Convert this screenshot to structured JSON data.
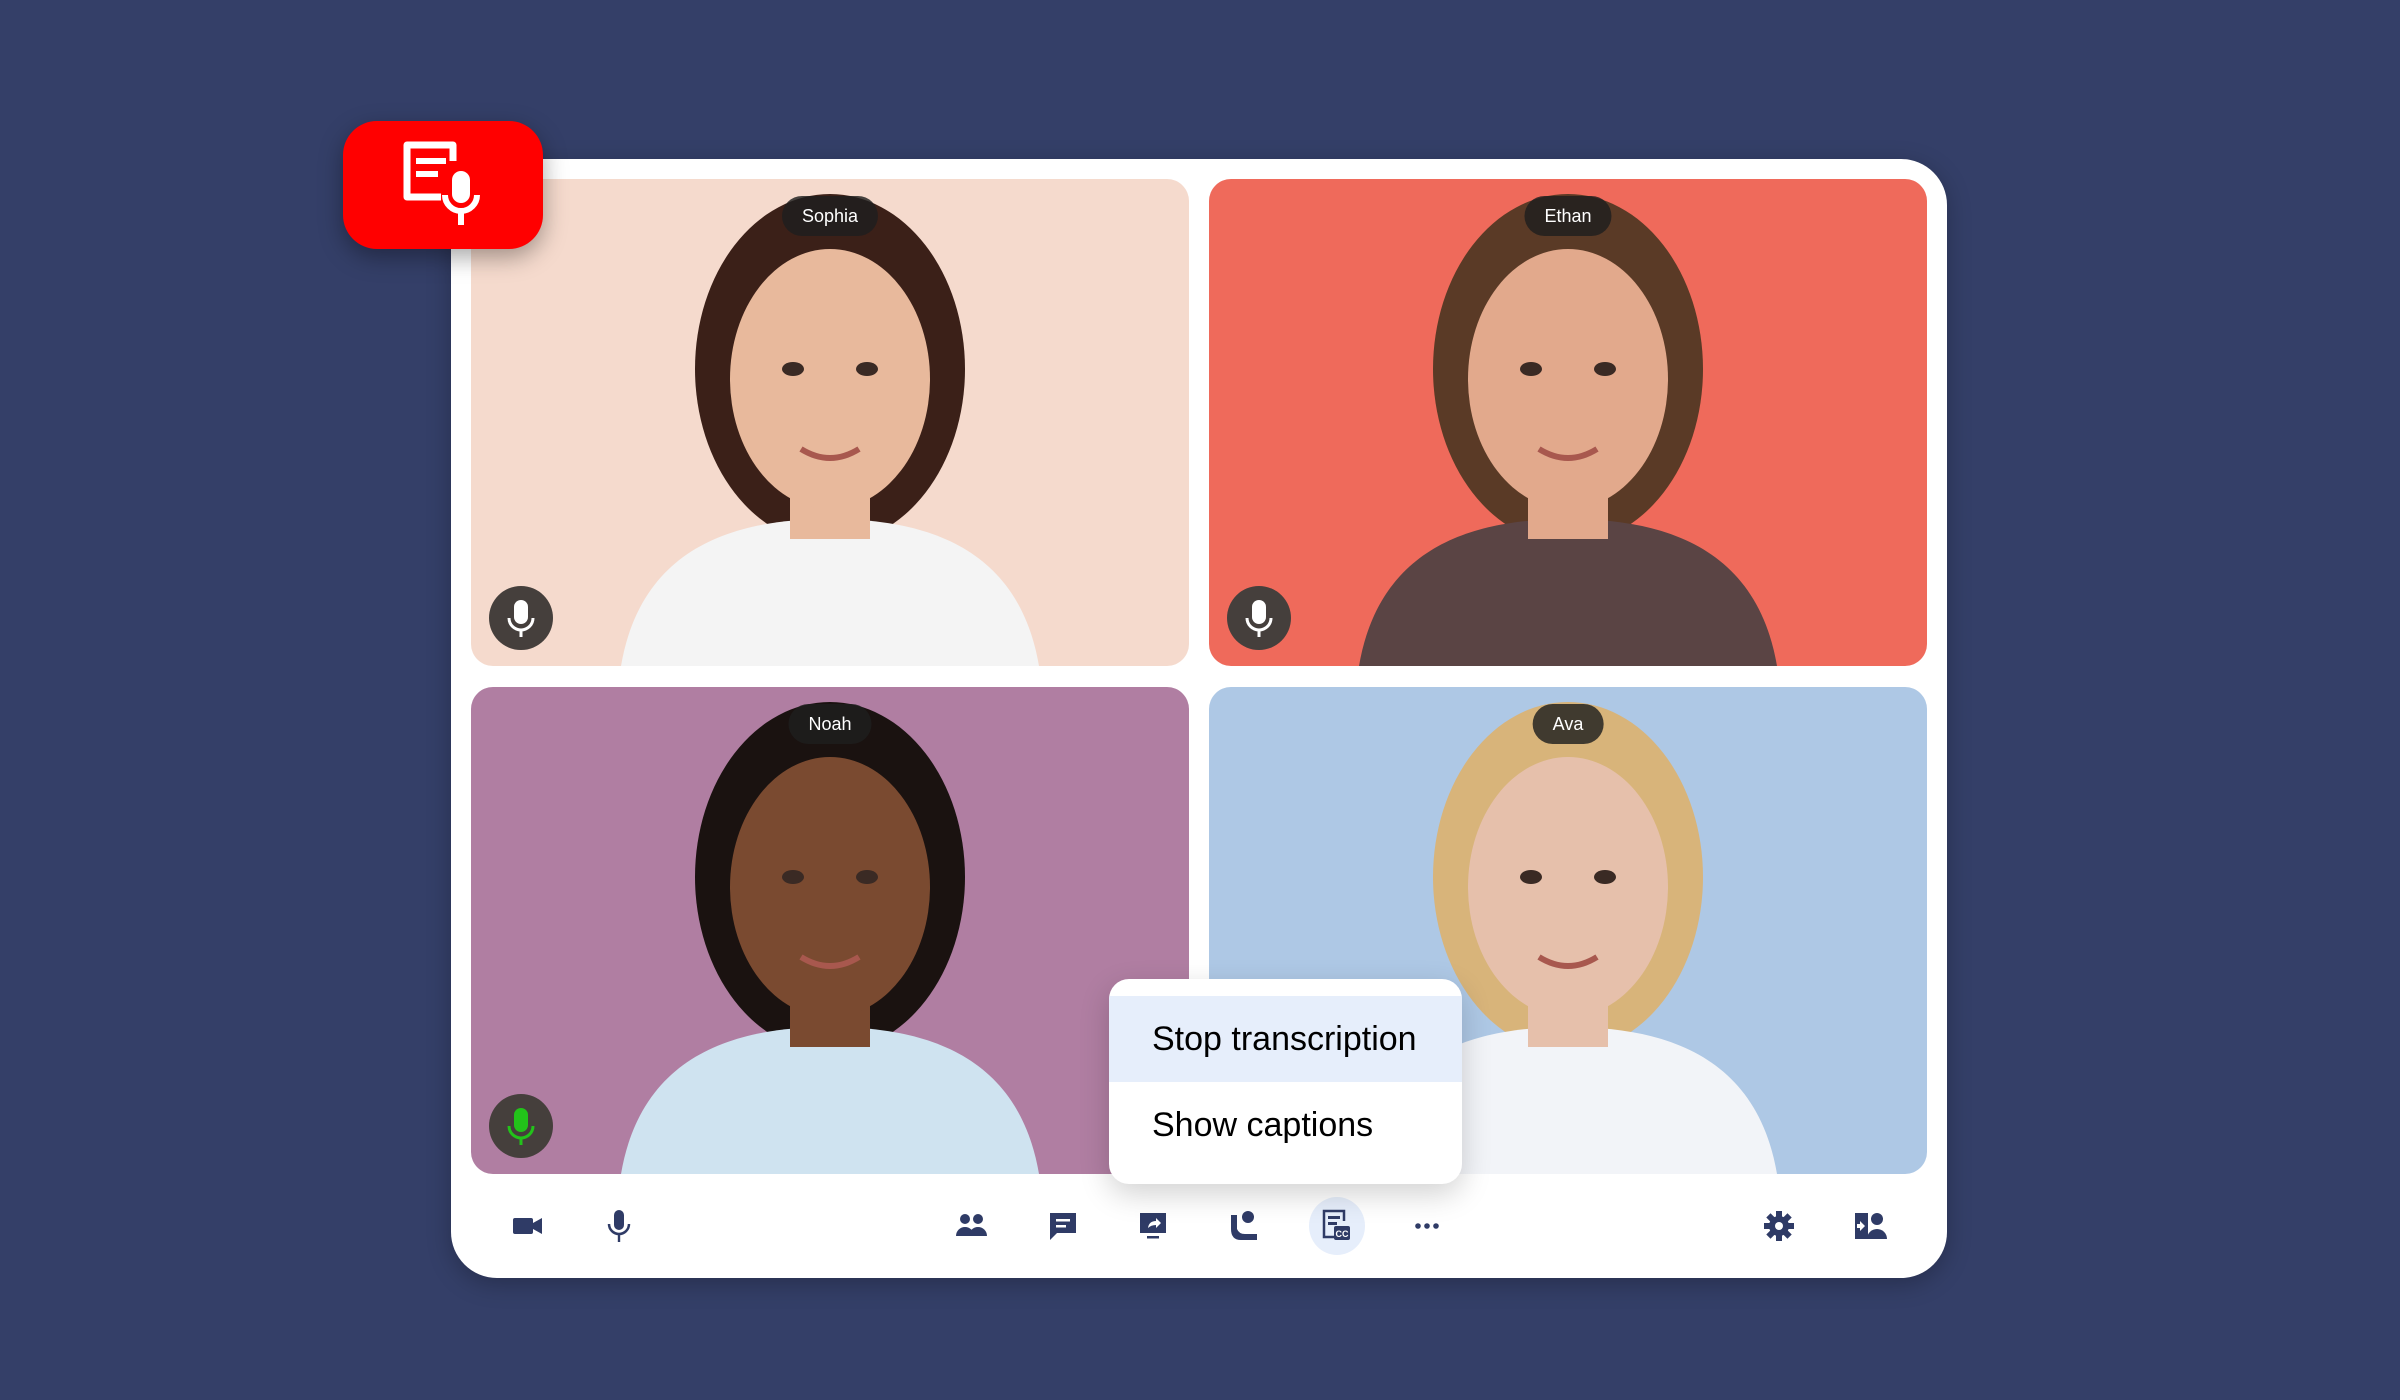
{
  "colors": {
    "background": "#343f68",
    "card": "#ffffff",
    "badge": "#ff0000",
    "icon": "#2f3b66",
    "active_highlight": "#e6eefb",
    "mic_active": "#22c31a",
    "mic_idle": "#ffffff"
  },
  "badge": {
    "icon": "transcription-icon"
  },
  "participants": [
    {
      "name": "Sophia",
      "bg": "#f5dacd",
      "mic": "mic-idle",
      "skin": "#e8b99c",
      "hair": "#3b2018",
      "shirt": "#f4f4f4"
    },
    {
      "name": "Ethan",
      "bg": "#ef6a5b",
      "mic": "mic-idle",
      "skin": "#e2a98c",
      "hair": "#5a3a26",
      "shirt": "#5a4444"
    },
    {
      "name": "Noah",
      "bg": "#b07ea2",
      "mic": "mic-active",
      "skin": "#7a4a30",
      "hair": "#1a1210",
      "shirt": "#cfe3f0"
    },
    {
      "name": "Ava",
      "bg": "#aec8e5",
      "mic": "mic-idle",
      "skin": "#e6c0ab",
      "hair": "#d8b47a",
      "shirt": "#f2f4f8"
    }
  ],
  "menu": {
    "items": [
      {
        "label": "Stop transcription",
        "highlighted": true
      },
      {
        "label": "Show captions",
        "highlighted": false
      }
    ]
  },
  "toolbar": {
    "buttons": [
      {
        "icon": "camera-icon"
      },
      {
        "icon": "microphone-icon"
      },
      {
        "icon": "participants-icon"
      },
      {
        "icon": "chat-icon"
      },
      {
        "icon": "share-screen-icon"
      },
      {
        "icon": "call-icon"
      },
      {
        "icon": "transcription-captions-icon",
        "active": true
      },
      {
        "icon": "more-icon"
      },
      {
        "icon": "settings-icon"
      },
      {
        "icon": "switch-user-icon"
      }
    ]
  }
}
